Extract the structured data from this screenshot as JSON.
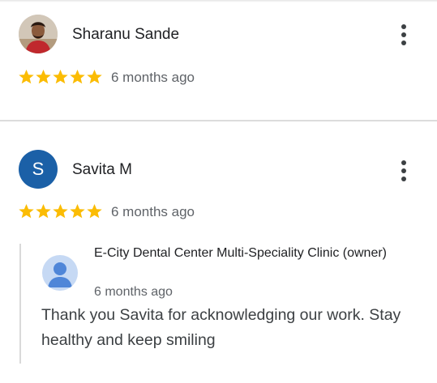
{
  "reviews": [
    {
      "name": "Sharanu Sande",
      "rating": 5,
      "date": "6 months ago",
      "avatar_type": "photo"
    },
    {
      "name": "Savita M",
      "initial": "S",
      "avatar_color": "#1b60a7",
      "rating": 5,
      "date": "6 months ago",
      "owner_reply": {
        "owner_name": "E-City Dental Center Multi-Speciality Clinic (owner)",
        "date": "6 months ago",
        "text": "Thank you Savita for acknowledging our work. Stay healthy and keep smiling"
      }
    }
  ],
  "colors": {
    "star": "#fbbc04",
    "secondary_text": "#5f6368",
    "owner_avatar_bg": "#c6d9f4",
    "owner_avatar_fg": "#4f86d8"
  },
  "icons": [
    "star-icon",
    "more-vert-icon",
    "person-icon"
  ]
}
